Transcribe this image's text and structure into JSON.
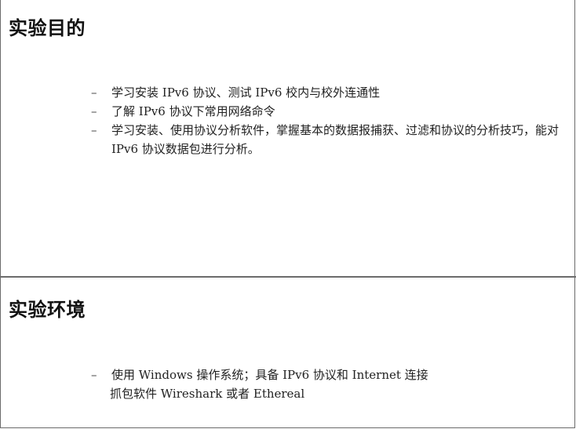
{
  "sections": [
    {
      "title": "实验目的",
      "items": [
        "学习安装 IPv6 协议、测试 IPv6 校内与校外连通性",
        "了解 IPv6 协议下常用网络命令",
        "学习安装、使用协议分析软件，掌握基本的数据报捕获、过滤和协议的分析技巧，能对 IPv6 协议数据包进行分析。"
      ]
    },
    {
      "title": "实验环境",
      "items": [
        "使用 Windows 操作系统；具备 IPv6 协议和 Internet 连接"
      ],
      "continuation": "抓包软件 Wireshark 或者 Ethereal"
    }
  ],
  "bullet_char": "–"
}
